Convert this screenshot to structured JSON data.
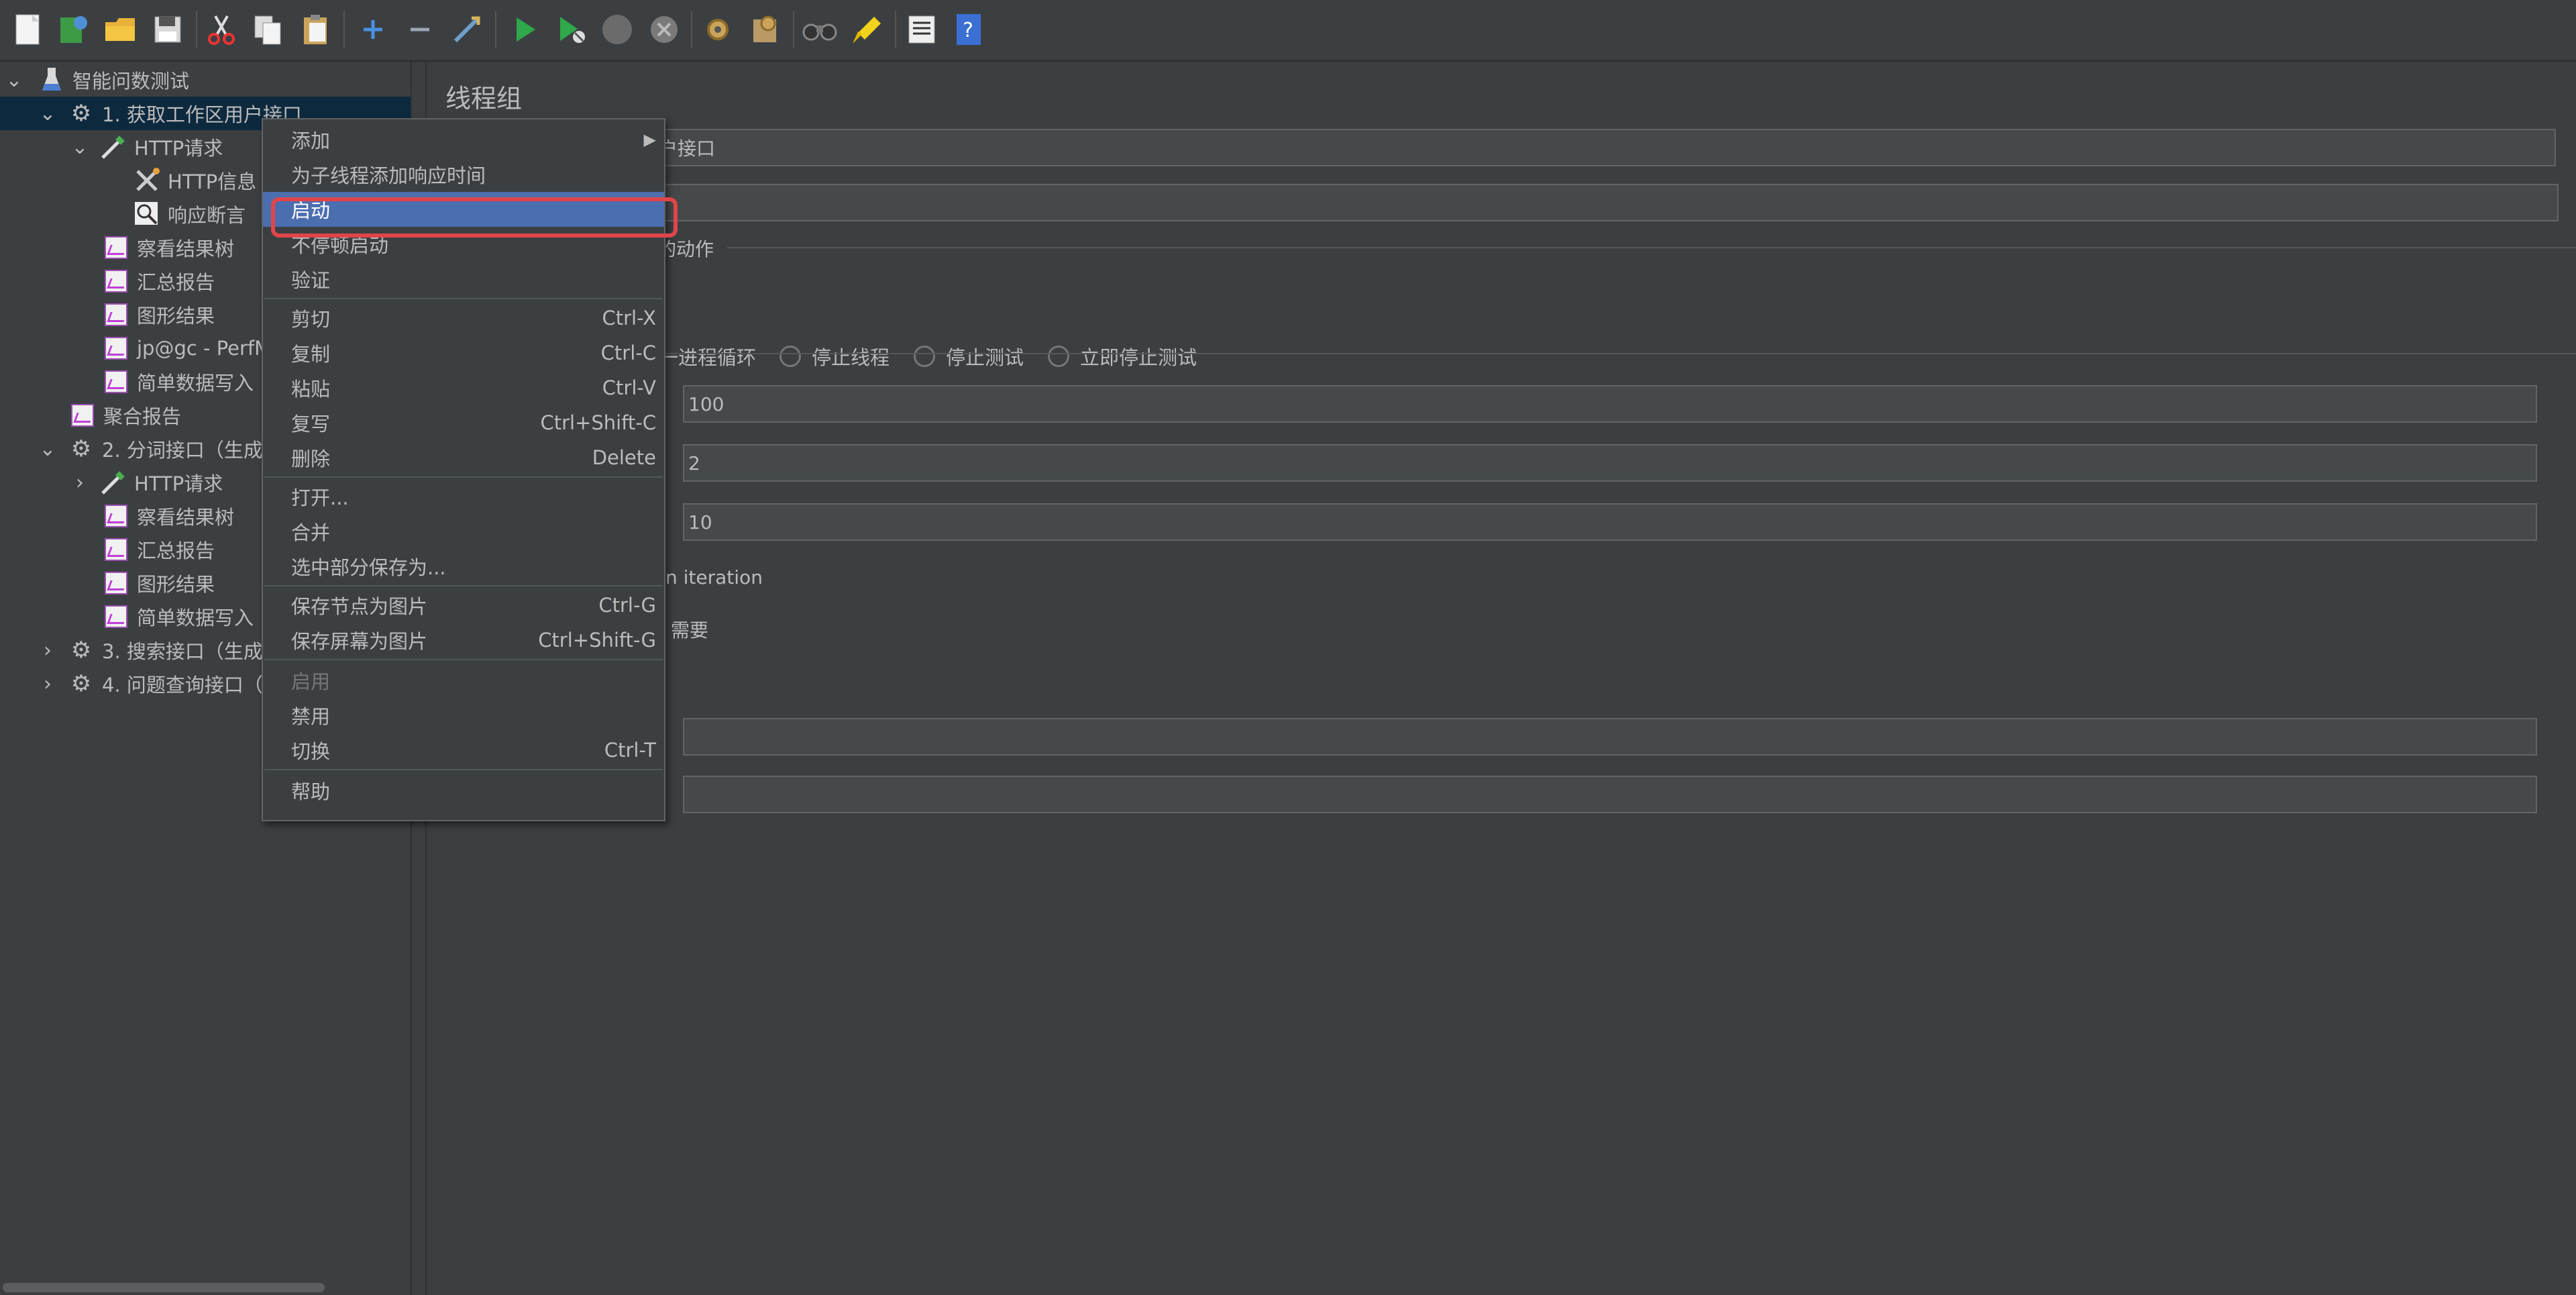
{
  "tree": {
    "items": [
      {
        "label": "智能问数测试"
      },
      {
        "label": "1. 获取工作区用户接口"
      },
      {
        "label": "HTTP请求"
      },
      {
        "label": "HTTP信息"
      },
      {
        "label": "响应断言"
      },
      {
        "label": "察看结果树"
      },
      {
        "label": "汇总报告"
      },
      {
        "label": "图形结果"
      },
      {
        "label": "jp@gc - PerfM"
      },
      {
        "label": "简单数据写入"
      },
      {
        "label": "聚合报告"
      },
      {
        "label": "2. 分词接口（生成"
      },
      {
        "label": "HTTP请求"
      },
      {
        "label": "察看结果树"
      },
      {
        "label": "汇总报告"
      },
      {
        "label": "图形结果"
      },
      {
        "label": "简单数据写入"
      },
      {
        "label": "3. 搜索接口（生成"
      },
      {
        "label": "4. 问题查询接口（"
      }
    ]
  },
  "panel": {
    "title": "线程组",
    "name_value": "户接口",
    "comment_value": "",
    "error_action_label": "的动作",
    "radios": [
      "一进程循环",
      "停止线程",
      "停止测试",
      "立即停止测试"
    ],
    "threads_value": "100",
    "rampup_value": "2",
    "loop_value": "10",
    "same_user_label": "n iteration",
    "delay_label": "需要",
    "duration_value": "",
    "startup_delay_value": ""
  },
  "context_menu": {
    "items": [
      {
        "label": "添加",
        "shortcut": ""
      },
      {
        "label": "为子线程添加响应时间",
        "shortcut": ""
      },
      {
        "label": "启动",
        "shortcut": ""
      },
      {
        "label": "不停顿启动",
        "shortcut": ""
      },
      {
        "label": "验证",
        "shortcut": ""
      },
      {
        "label": "剪切",
        "shortcut": "Ctrl-X"
      },
      {
        "label": "复制",
        "shortcut": "Ctrl-C"
      },
      {
        "label": "粘贴",
        "shortcut": "Ctrl-V"
      },
      {
        "label": "复写",
        "shortcut": "Ctrl+Shift-C"
      },
      {
        "label": "删除",
        "shortcut": "Delete"
      },
      {
        "label": "打开...",
        "shortcut": ""
      },
      {
        "label": "合并",
        "shortcut": ""
      },
      {
        "label": "选中部分保存为...",
        "shortcut": ""
      },
      {
        "label": "保存节点为图片",
        "shortcut": "Ctrl-G"
      },
      {
        "label": "保存屏幕为图片",
        "shortcut": "Ctrl+Shift-G"
      },
      {
        "label": "启用",
        "shortcut": ""
      },
      {
        "label": "禁用",
        "shortcut": ""
      },
      {
        "label": "切换",
        "shortcut": "Ctrl-T"
      },
      {
        "label": "帮助",
        "shortcut": ""
      }
    ]
  },
  "colors": {
    "background": "#3c3f41",
    "selection": "#0d293e",
    "menu_highlight": "#4b6eaf",
    "annotation_box": "#e0454a"
  }
}
